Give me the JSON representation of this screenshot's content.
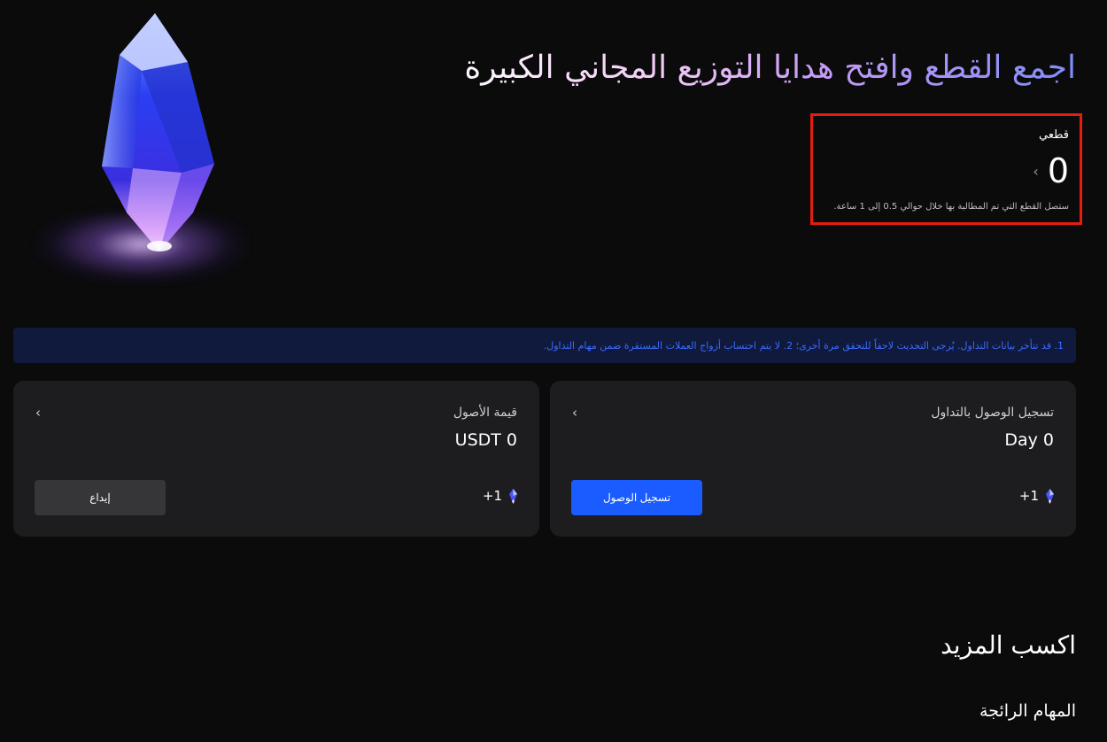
{
  "hero": {
    "headline": "اجمع القطع وافتح هدايا التوزيع المجاني الكبيرة"
  },
  "pieces": {
    "label": "قطعي",
    "count": "0",
    "note": "ستصل القطع التي تم المطالبة بها خلال حوالي 0.5 إلى 1 ساعة."
  },
  "notice": {
    "text": "1. قد تتأخر بيانات التداول. يُرجى التحديث لاحقاً للتحقق مرة أخرى؛ 2. لا يتم احتساب أزواج العملات المستقرة ضمن مهام التداول."
  },
  "cards": {
    "trading_checkin": {
      "title": "تسجيل الوصول بالتداول",
      "value": "Day 0",
      "reward": "+1",
      "button": "تسجيل الوصول"
    },
    "asset_value": {
      "title": "قيمة الأصول",
      "value": "USDT 0",
      "reward": "+1",
      "button": "إيداع"
    }
  },
  "earn_more": {
    "title": "اكسب المزيد",
    "popular_tasks": "المهام الرائجة"
  },
  "colors": {
    "background": "#0b0b0c",
    "card": "#1d1d1f",
    "accent": "#1a5cff",
    "highlight_border": "#e31d0f",
    "notice_text": "#3d6bff"
  },
  "icons": [
    "crystal-icon",
    "chevron-right-icon",
    "chevron-left-icon",
    "gem-icon"
  ]
}
